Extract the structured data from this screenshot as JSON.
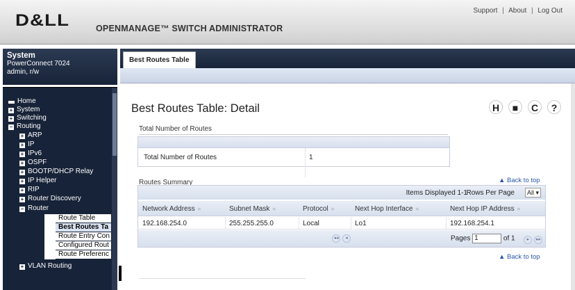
{
  "header": {
    "logo": "D&LL",
    "app_name": "OPENMANAGE™ SWITCH ADMINISTRATOR",
    "links": [
      "Support",
      "About",
      "Log Out"
    ],
    "link_separator": "|"
  },
  "system": {
    "title": "System",
    "model": "PowerConnect 7024",
    "user": "admin, r/w"
  },
  "nav": {
    "items": [
      {
        "label": "Home",
        "icon": "home-icon"
      },
      {
        "label": "System",
        "icon": "expand-icon"
      },
      {
        "label": "Switching",
        "icon": "expand-icon"
      },
      {
        "label": "Routing",
        "icon": "collapse-icon"
      },
      {
        "label": "ARP",
        "icon": "expand-icon"
      },
      {
        "label": "IP",
        "icon": "expand-icon"
      },
      {
        "label": "IPv6",
        "icon": "expand-icon"
      },
      {
        "label": "OSPF",
        "icon": "expand-icon"
      },
      {
        "label": "BOOTP/DHCP Relay",
        "icon": "expand-icon"
      },
      {
        "label": "IP Helper",
        "icon": "expand-icon"
      },
      {
        "label": "RIP",
        "icon": "expand-icon"
      },
      {
        "label": "Router Discovery",
        "icon": "expand-icon"
      },
      {
        "label": "Router",
        "icon": "collapse-icon"
      },
      {
        "label": "VLAN Routing",
        "icon": "expand-icon"
      }
    ],
    "leaves": [
      "Route Table",
      "Best Routes Ta",
      "Route Entry Con",
      "Configured Rout",
      "Route Preferenc"
    ],
    "selected_leaf": "Best Routes Ta"
  },
  "tabs": [
    "Best Routes Table"
  ],
  "page": {
    "title": "Best Routes Table: Detail",
    "icons": [
      "help-h-icon",
      "print-icon",
      "refresh-icon",
      "question-icon"
    ],
    "icon_glyphs": [
      "H",
      "■",
      "C",
      "?"
    ]
  },
  "total": {
    "section_title": "Total Number of Routes",
    "label": "Total Number of Routes",
    "value": "1"
  },
  "summary": {
    "section_title": "Routes Summary",
    "back_to_top": "▲ Back to top",
    "items_displayed": "Items Displayed 1-1",
    "rows_per_page_label": "Rows Per Page",
    "rows_per_page_value": "All",
    "columns": [
      "Network Address",
      "Subnet Mask",
      "Protocol",
      "Next Hop Interface",
      "Next Hop IP Address"
    ],
    "rows": [
      [
        "192.168.254.0",
        "255.255.255.0",
        "Local",
        "Lo1",
        "192.168.254.1"
      ]
    ],
    "pages_label": "Pages",
    "page_value": "1",
    "of_label": "of 1"
  }
}
